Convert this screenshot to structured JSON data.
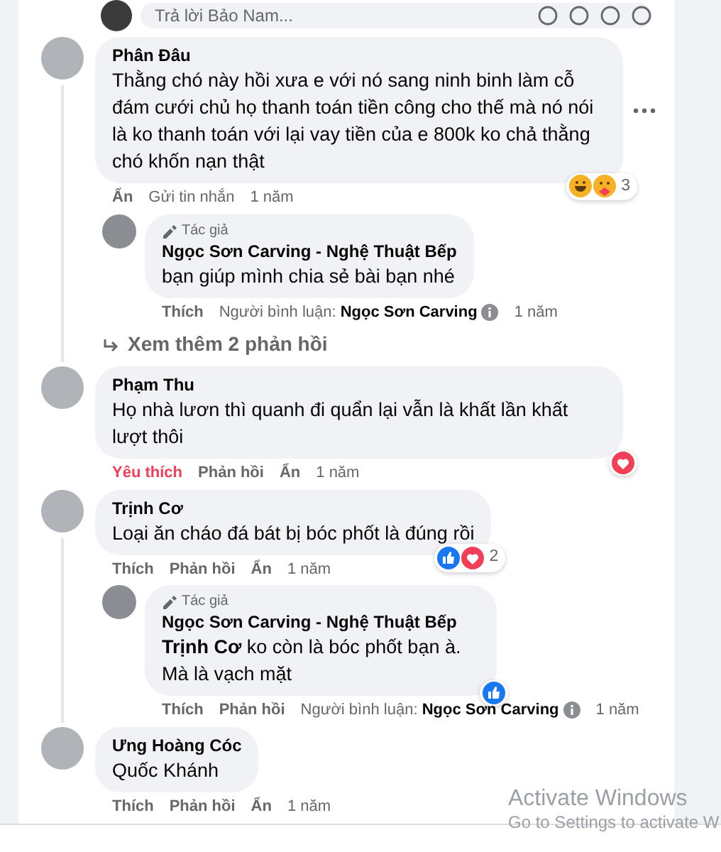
{
  "reply_box": {
    "placeholder": "Trả lời Bảo Nam..."
  },
  "comments": [
    {
      "kind": "comment",
      "name": "Phân Đâu",
      "text": "Thằng chó này hồi xưa e với nó sang ninh binh làm cỗ đám cưới chủ họ thanh toán tiền công cho thế mà nó nói là ko thanh toán với lại vay tiền của e 800k ko chả thằng chó khốn nạn thật",
      "show_more_menu": true,
      "actions": [
        {
          "kind": "hide",
          "label": "Ẩn"
        },
        {
          "kind": "message",
          "label": "Gửi tin nhắn"
        }
      ],
      "time": "1 năm",
      "reactions": {
        "icons": [
          {
            "kind": "haha"
          },
          {
            "kind": "care"
          }
        ],
        "count": "3"
      },
      "replies": [
        {
          "kind": "author",
          "badge": "Tác giả",
          "name": "Ngọc Sơn Carving - Nghệ Thuật Bếp",
          "text": "bạn giúp mình chia sẻ bài bạn nhé",
          "actions": [
            {
              "kind": "react",
              "label": "Thích",
              "selected": false
            },
            {
              "kind": "commenter",
              "label": "Người bình luận: **Ngọc Sơn Carving**"
            }
          ],
          "time": "1 năm"
        }
      ],
      "more_replies": "Xem thêm 2 phản hồi"
    },
    {
      "kind": "comment",
      "name": "Phạm Thu",
      "text": "Họ nhà lươn thì quanh đi quẩn lại vẫn là khất lần khất lượt thôi",
      "actions": [
        {
          "kind": "react",
          "label": "Yêu thích",
          "selected": true
        },
        {
          "kind": "reply",
          "label": "Phản hồi"
        },
        {
          "kind": "hide",
          "label": "Ẩn"
        }
      ],
      "time": "1 năm",
      "reactions": {
        "icons": [
          {
            "kind": "love"
          }
        ]
      }
    },
    {
      "kind": "comment",
      "name": "Trịnh Cơ",
      "text": "Loại ăn cháo đá bát bị bóc phốt là đúng rồi",
      "actions": [
        {
          "kind": "react",
          "label": "Thích",
          "selected": false
        },
        {
          "kind": "reply",
          "label": "Phản hồi"
        },
        {
          "kind": "hide",
          "label": "Ẩn"
        }
      ],
      "time": "1 năm",
      "reactions": {
        "icons": [
          {
            "kind": "like"
          },
          {
            "kind": "love"
          }
        ],
        "count": "2"
      },
      "replies": [
        {
          "kind": "author",
          "badge": "Tác giả",
          "name": "Ngọc Sơn Carving - Nghệ Thuật Bếp",
          "text": "**Trịnh Cơ** ko còn là bóc phốt bạn à. Mà là vạch mặt",
          "actions": [
            {
              "kind": "react",
              "label": "Thích",
              "selected": false
            },
            {
              "kind": "reply",
              "label": "Phản hồi"
            },
            {
              "kind": "commenter",
              "label": "Người bình luận: **Ngọc Sơn Carving**"
            }
          ],
          "time": "1 năm",
          "reactions": {
            "icons": [
              {
                "kind": "like"
              }
            ]
          }
        }
      ]
    },
    {
      "kind": "comment",
      "name": "Ưng Hoàng Cóc",
      "text": "Quốc Khánh",
      "actions": [
        {
          "kind": "react",
          "label": "Thích",
          "selected": false
        },
        {
          "kind": "reply",
          "label": "Phản hồi"
        },
        {
          "kind": "hide",
          "label": "Ẩn"
        }
      ],
      "time": "1 năm"
    }
  ],
  "os_notice": {
    "title": "Activate Windows",
    "text": "Go to Settings to activate W"
  }
}
